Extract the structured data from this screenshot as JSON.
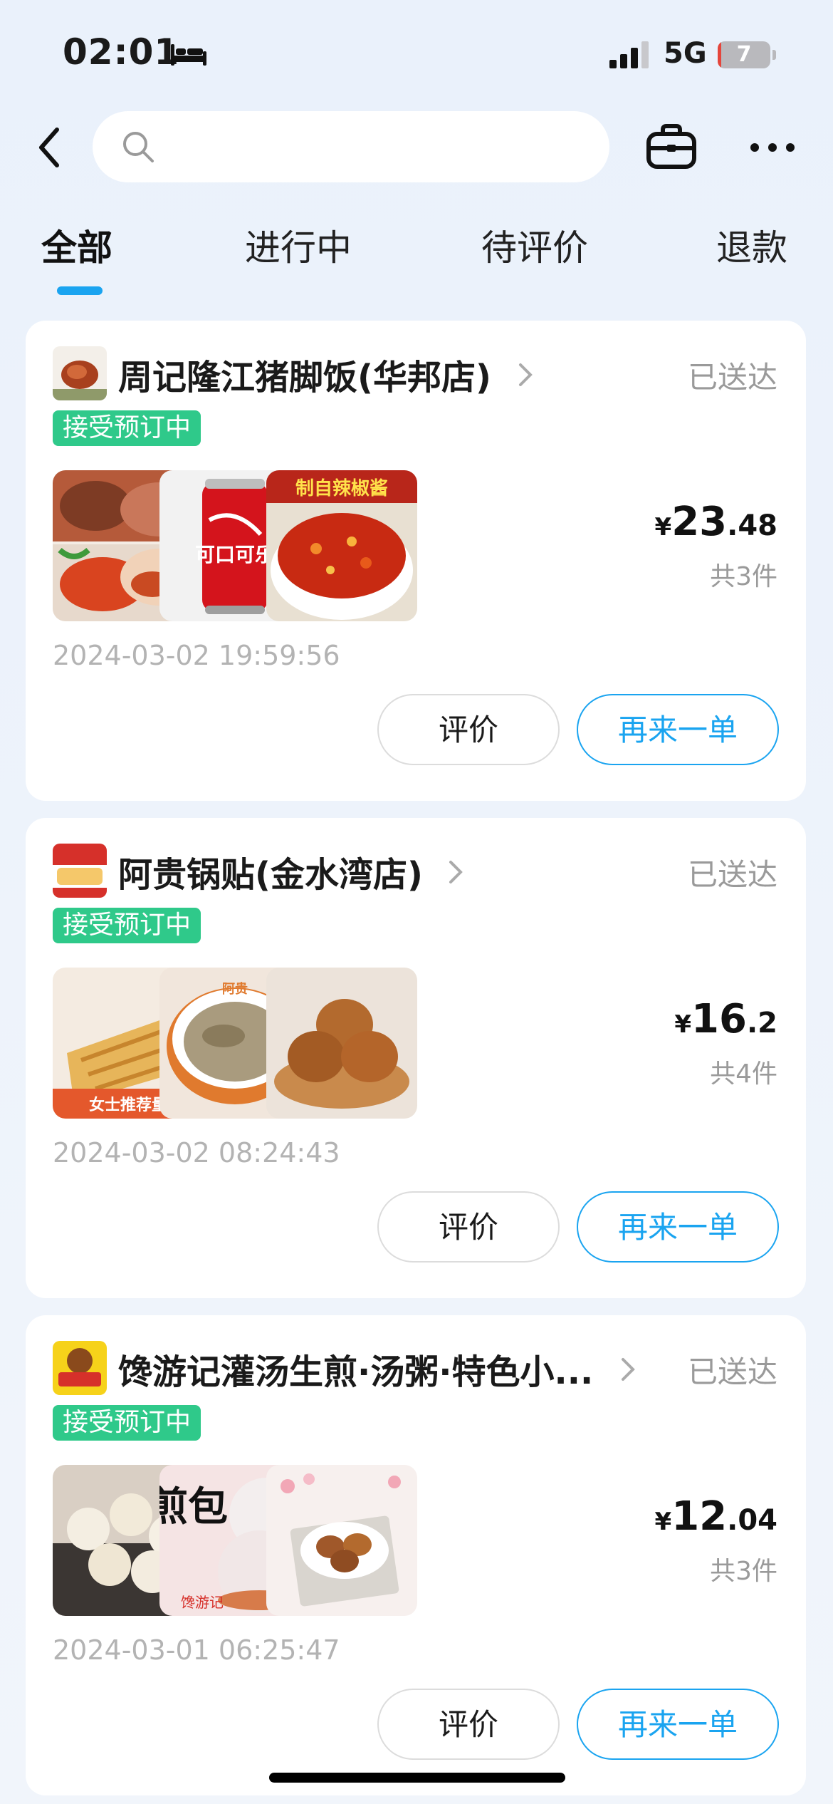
{
  "status_bar": {
    "time": "02:01",
    "network": "5G",
    "battery_level": "7",
    "battery_fraction": 0.07,
    "battery_color": "#e5453b"
  },
  "nav": {
    "back_icon": "chevron-left-icon",
    "search_icon": "search-icon",
    "search_placeholder": "",
    "bag_icon": "briefcase-icon",
    "more_icon": "more-dots-icon"
  },
  "tabs": [
    {
      "label": "全部",
      "active": true
    },
    {
      "label": "进行中",
      "active": false
    },
    {
      "label": "待评价",
      "active": false
    },
    {
      "label": "退款",
      "active": false
    }
  ],
  "accent_color": "#1aa4f0",
  "badge_color": "#2fc98a",
  "orders": [
    {
      "shop_name": "周记隆江猪脚饭(华邦店)",
      "status": "已送达",
      "badge": "接受预订中",
      "price_currency": "¥",
      "price_int": "23",
      "price_dec": ".48",
      "count": "共3件",
      "time": "2024-03-02 19:59:56",
      "review_label": "评价",
      "reorder_label": "再来一单",
      "items": [
        "pork-knuckle-rice-image",
        "coca-cola-can-image",
        "chili-sauce-image"
      ],
      "item_texts": {
        "cola": "可口可乐",
        "sauce": "制自辣椒酱"
      }
    },
    {
      "shop_name": "阿贵锅贴(金水湾店)",
      "status": "已送达",
      "badge": "接受预订中",
      "price_currency": "¥",
      "price_int": "16",
      "price_dec": ".2",
      "count": "共4件",
      "time": "2024-03-02 08:24:43",
      "review_label": "评价",
      "reorder_label": "再来一单",
      "items": [
        "potstickers-image",
        "soup-bowl-image",
        "tea-eggs-image"
      ],
      "item_texts": {
        "potstickers_caption": "女士推荐量",
        "bowl_label": "阿贵"
      }
    },
    {
      "shop_name": "馋游记灌汤生煎·汤粥·特色小...",
      "status": "已送达",
      "badge": "接受预订中",
      "price_currency": "¥",
      "price_int": "12",
      "price_dec": ".04",
      "count": "共3件",
      "time": "2024-03-01 06:25:47",
      "review_label": "评价",
      "reorder_label": "再来一单",
      "items": [
        "pan-fried-buns-image",
        "jianbao-image",
        "braised-eggs-image"
      ],
      "item_texts": {
        "jianbao": "煎包",
        "brand": "馋游记"
      }
    }
  ]
}
